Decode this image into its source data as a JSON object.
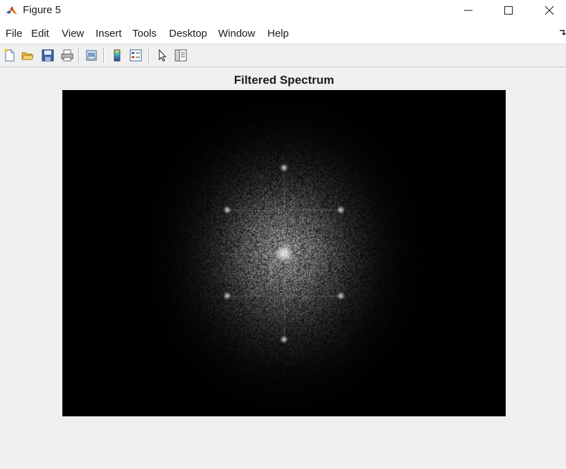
{
  "window": {
    "title": "Figure 5"
  },
  "menu": {
    "items": [
      "File",
      "Edit",
      "View",
      "Insert",
      "Tools",
      "Desktop",
      "Window",
      "Help"
    ]
  },
  "toolbar": {
    "buttons": [
      {
        "name": "new-figure",
        "icon": "new-document-icon"
      },
      {
        "name": "open-file",
        "icon": "folder-open-icon"
      },
      {
        "name": "save",
        "icon": "save-icon"
      },
      {
        "name": "print",
        "icon": "print-icon"
      },
      {
        "name": "link-plot",
        "icon": "print-preview-icon"
      },
      {
        "name": "insert-colorbar",
        "icon": "colorbar-icon"
      },
      {
        "name": "insert-legend",
        "icon": "legend-icon"
      },
      {
        "name": "edit-plot",
        "icon": "pointer-arrow-icon"
      },
      {
        "name": "property-inspector",
        "icon": "panel-icon"
      }
    ]
  },
  "figure": {
    "title": "Filtered Spectrum",
    "image": {
      "description_type": "grayscale magnitude spectrum",
      "colormap": "gray",
      "background": "#000000"
    }
  },
  "colors": {
    "matlab_orange": "#e06a1f",
    "matlab_blue": "#2b5fa6",
    "window_bg": "#f0f0f0"
  }
}
